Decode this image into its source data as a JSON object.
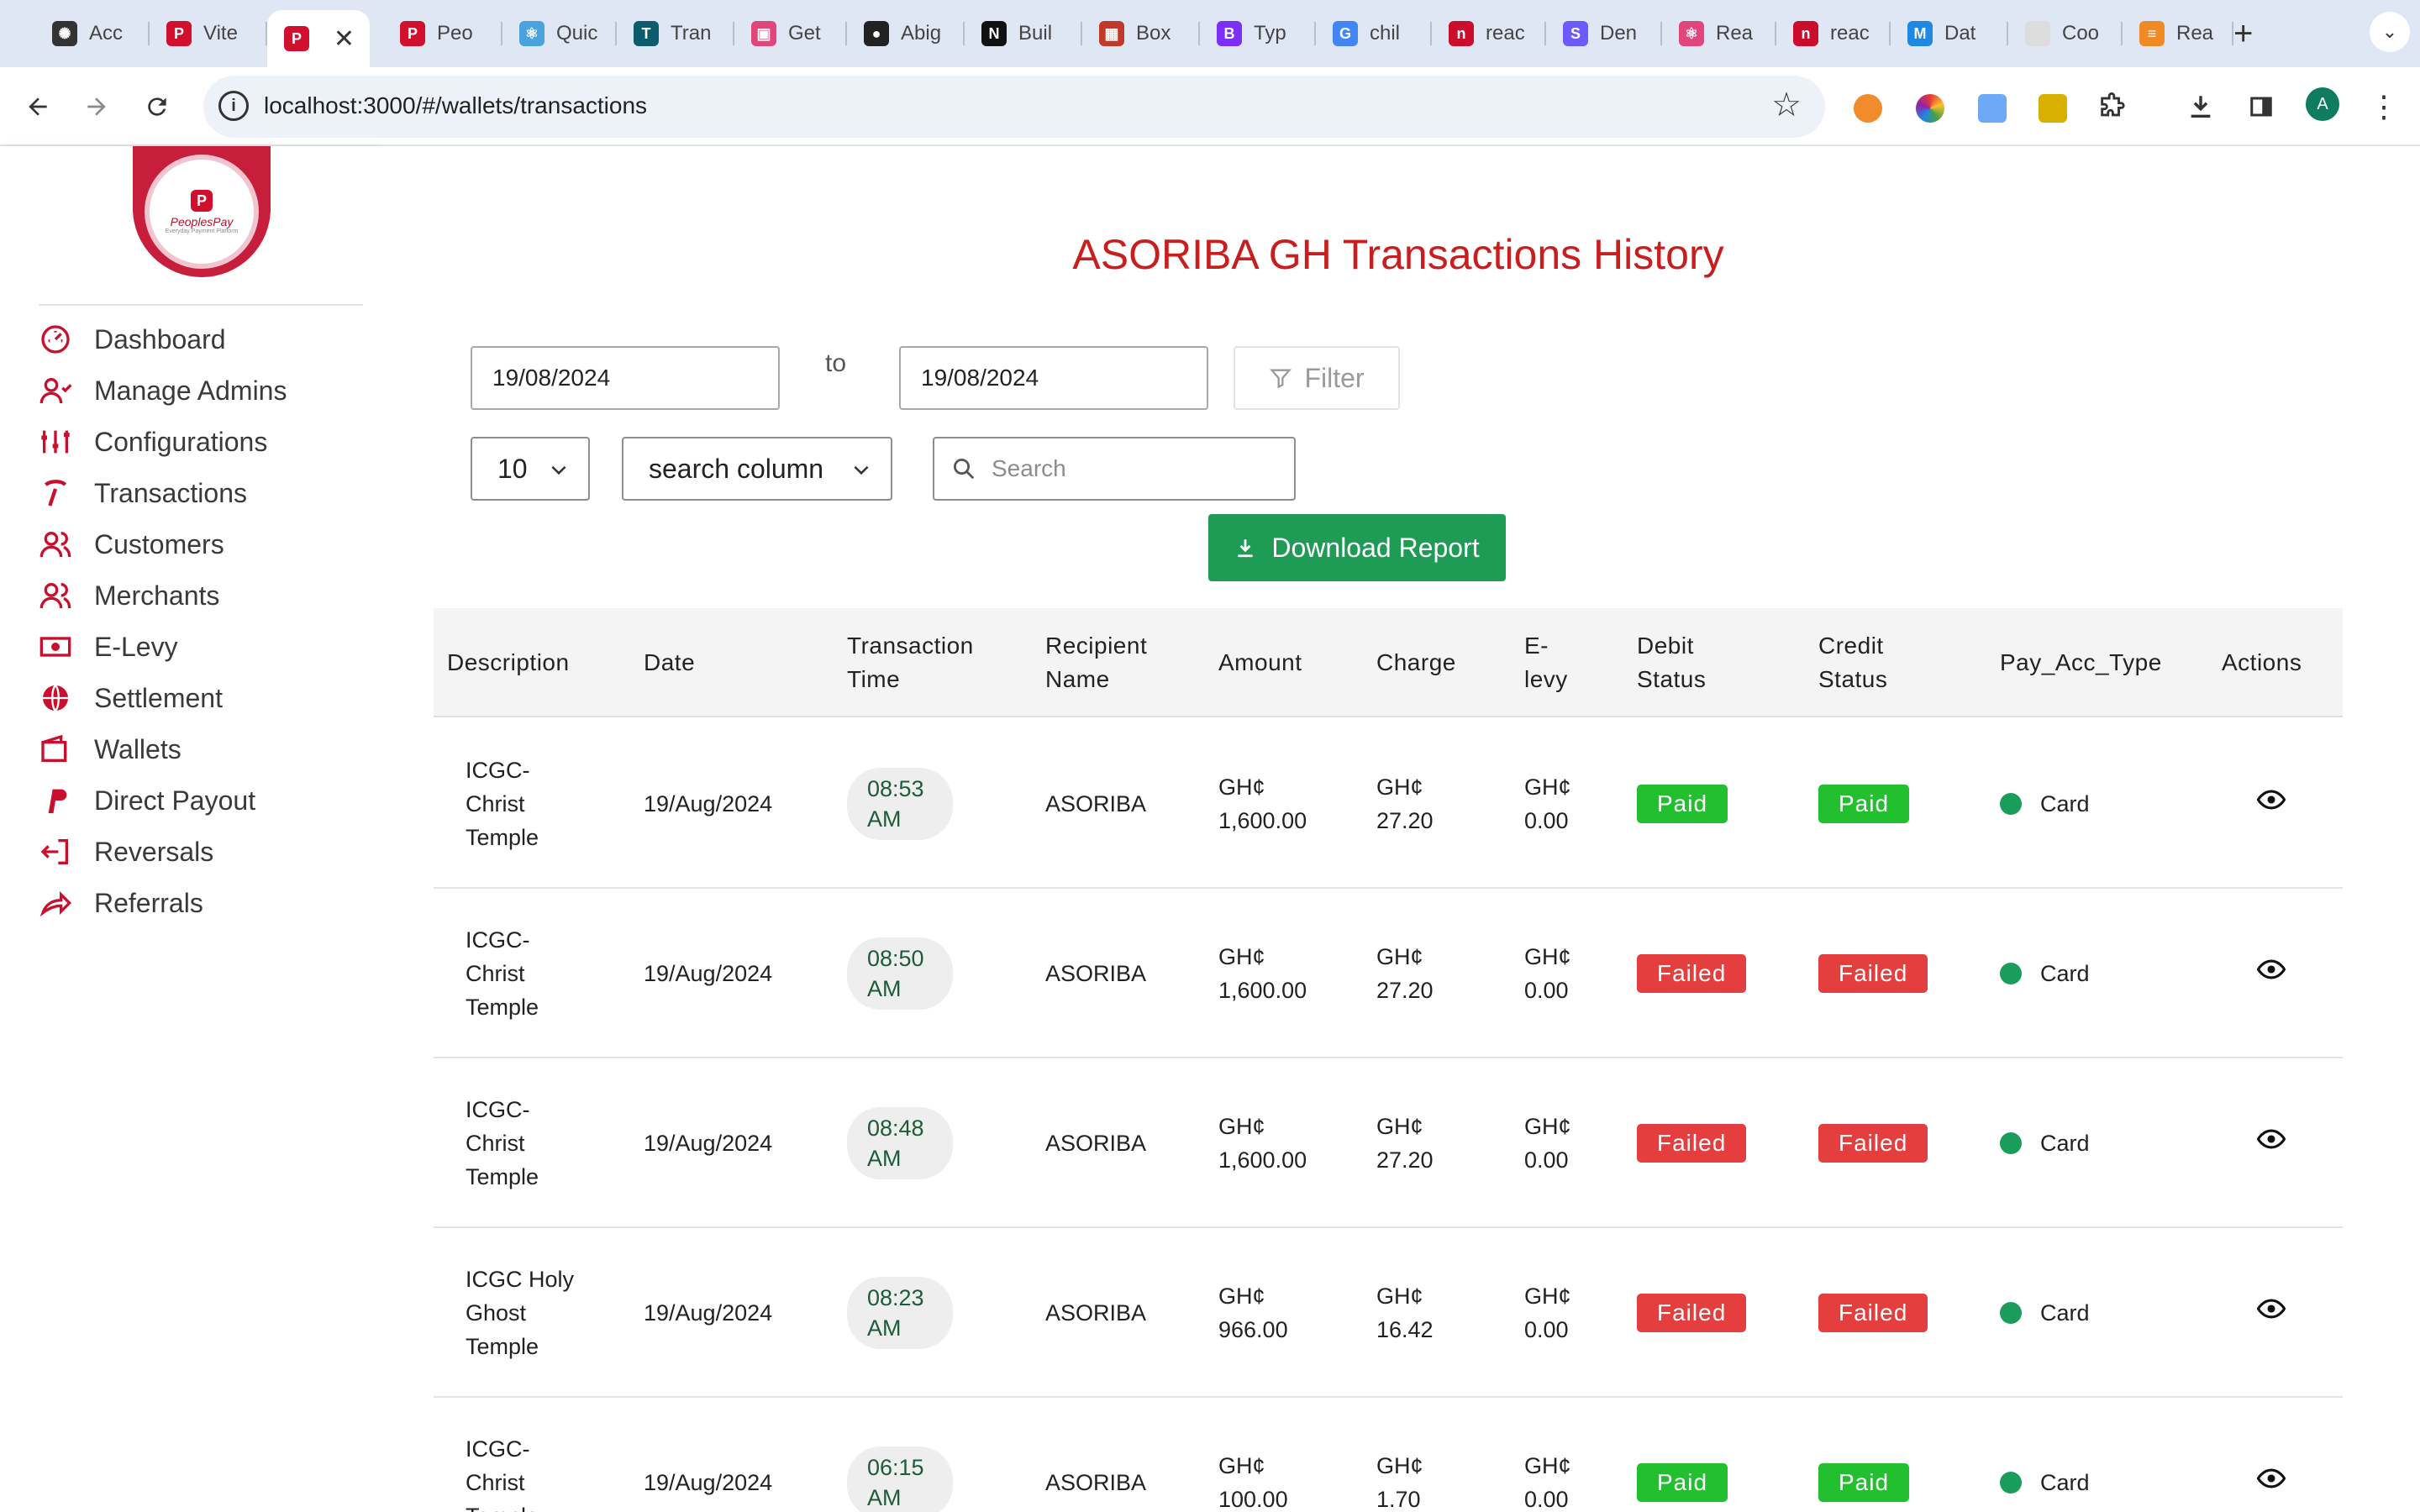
{
  "browser": {
    "tabs": [
      {
        "label": "Acc",
        "icon": "openai-icon",
        "color": "#333333",
        "glyph": "✺"
      },
      {
        "label": "Vite",
        "icon": "peoplespay-icon",
        "color": "#d0102d",
        "glyph": "P"
      },
      {
        "label": "",
        "icon": "peoplespay-icon",
        "color": "#d0102d",
        "glyph": "P"
      },
      {
        "label": "Peo",
        "icon": "peoplespay-icon",
        "color": "#d0102d",
        "glyph": "P"
      },
      {
        "label": "Quic",
        "icon": "react-icon",
        "color": "#4aa3df",
        "glyph": "⚛"
      },
      {
        "label": "Tran",
        "icon": "translate-icon",
        "color": "#0d5c6e",
        "glyph": "T"
      },
      {
        "label": "Get",
        "icon": "app-icon",
        "color": "#e0457b",
        "glyph": "▣"
      },
      {
        "label": "Abig",
        "icon": "github-icon",
        "color": "#222222",
        "glyph": "●"
      },
      {
        "label": "Buil",
        "icon": "nextjs-icon",
        "color": "#111111",
        "glyph": "N"
      },
      {
        "label": "Box",
        "icon": "box-icon",
        "color": "#c0392b",
        "glyph": "▦"
      },
      {
        "label": "Typ",
        "icon": "bootstrap-icon",
        "color": "#7b2ff7",
        "glyph": "B"
      },
      {
        "label": "chil",
        "icon": "google-icon",
        "color": "#4285f4",
        "glyph": "G"
      },
      {
        "label": "reac",
        "icon": "npm-icon",
        "color": "#cb0c2b",
        "glyph": "n"
      },
      {
        "label": "Den",
        "icon": "stripe-icon",
        "color": "#6b5bff",
        "glyph": "S"
      },
      {
        "label": "Rea",
        "icon": "react-icon",
        "color": "#e0457b",
        "glyph": "⚛"
      },
      {
        "label": "reac",
        "icon": "npm-icon",
        "color": "#cb0c2b",
        "glyph": "n"
      },
      {
        "label": "Dat",
        "icon": "mui-icon",
        "color": "#1e88e5",
        "glyph": "M"
      },
      {
        "label": "Coo",
        "icon": "page-icon",
        "color": "#dddddd",
        "glyph": ""
      },
      {
        "label": "Rea",
        "icon": "app-icon",
        "color": "#f08a24",
        "glyph": "≡"
      }
    ],
    "url": "localhost:3000/#/wallets/transactions",
    "profile_initial": "A"
  },
  "sidebar": {
    "logo_text": "PeoplesPay",
    "logo_tagline": "Everyday Payment Platform",
    "items": [
      {
        "label": "Dashboard",
        "icon": "dashboard-icon"
      },
      {
        "label": "Manage Admins",
        "icon": "admin-user-icon"
      },
      {
        "label": "Configurations",
        "icon": "sliders-icon"
      },
      {
        "label": "Transactions",
        "icon": "transactions-icon"
      },
      {
        "label": "Customers",
        "icon": "customers-icon"
      },
      {
        "label": "Merchants",
        "icon": "merchants-icon"
      },
      {
        "label": "E-Levy",
        "icon": "money-icon"
      },
      {
        "label": "Settlement",
        "icon": "globe-icon"
      },
      {
        "label": "Wallets",
        "icon": "wallet-icon"
      },
      {
        "label": "Direct Payout",
        "icon": "paypal-icon"
      },
      {
        "label": "Reversals",
        "icon": "reversal-icon"
      },
      {
        "label": "Referrals",
        "icon": "share-icon"
      }
    ]
  },
  "page": {
    "title": "ASORIBA GH Transactions History",
    "date_from": "19/08/2024",
    "to_label": "to",
    "date_to": "19/08/2024",
    "filter_label": "Filter",
    "page_size": "10",
    "search_column_label": "search column",
    "search_placeholder": "Search",
    "download_label": "Download Report"
  },
  "table": {
    "headers": [
      "Description",
      "Date",
      "Transaction Time",
      "Recipient Name",
      "Amount",
      "Charge",
      "E-levy",
      "Debit Status",
      "Credit Status",
      "Pay_Acc_Type",
      "Actions"
    ],
    "rows": [
      {
        "description": "ICGC-\nChrist\nTemple",
        "date": "19/Aug/2024",
        "time": "08:53\nAM",
        "recipient": "ASORIBA",
        "amount": "GH¢\n1,600.00",
        "charge": "GH¢\n27.20",
        "elevy": "GH¢\n0.00",
        "debit_status": "Paid",
        "credit_status": "Paid",
        "pay_acc_type": "Card"
      },
      {
        "description": "ICGC-\nChrist\nTemple",
        "date": "19/Aug/2024",
        "time": "08:50\nAM",
        "recipient": "ASORIBA",
        "amount": "GH¢\n1,600.00",
        "charge": "GH¢\n27.20",
        "elevy": "GH¢\n0.00",
        "debit_status": "Failed",
        "credit_status": "Failed",
        "pay_acc_type": "Card"
      },
      {
        "description": "ICGC-\nChrist\nTemple",
        "date": "19/Aug/2024",
        "time": "08:48\nAM",
        "recipient": "ASORIBA",
        "amount": "GH¢\n1,600.00",
        "charge": "GH¢\n27.20",
        "elevy": "GH¢\n0.00",
        "debit_status": "Failed",
        "credit_status": "Failed",
        "pay_acc_type": "Card"
      },
      {
        "description": "ICGC Holy\nGhost\nTemple",
        "date": "19/Aug/2024",
        "time": "08:23\nAM",
        "recipient": "ASORIBA",
        "amount": "GH¢\n966.00",
        "charge": "GH¢\n16.42",
        "elevy": "GH¢\n0.00",
        "debit_status": "Failed",
        "credit_status": "Failed",
        "pay_acc_type": "Card"
      },
      {
        "description": "ICGC-\nChrist\nTemple",
        "date": "19/Aug/2024",
        "time": "06:15\nAM",
        "recipient": "ASORIBA",
        "amount": "GH¢\n100.00",
        "charge": "GH¢\n1.70",
        "elevy": "GH¢\n0.00",
        "debit_status": "Paid",
        "credit_status": "Paid",
        "pay_acc_type": "Card"
      }
    ]
  },
  "colors": {
    "title": "#c81e1e",
    "paid": "#22c02e",
    "failed": "#e53e3e",
    "download": "#1e9b55",
    "brand": "#c71e3c",
    "sidebar_icon": "#c8102e"
  }
}
